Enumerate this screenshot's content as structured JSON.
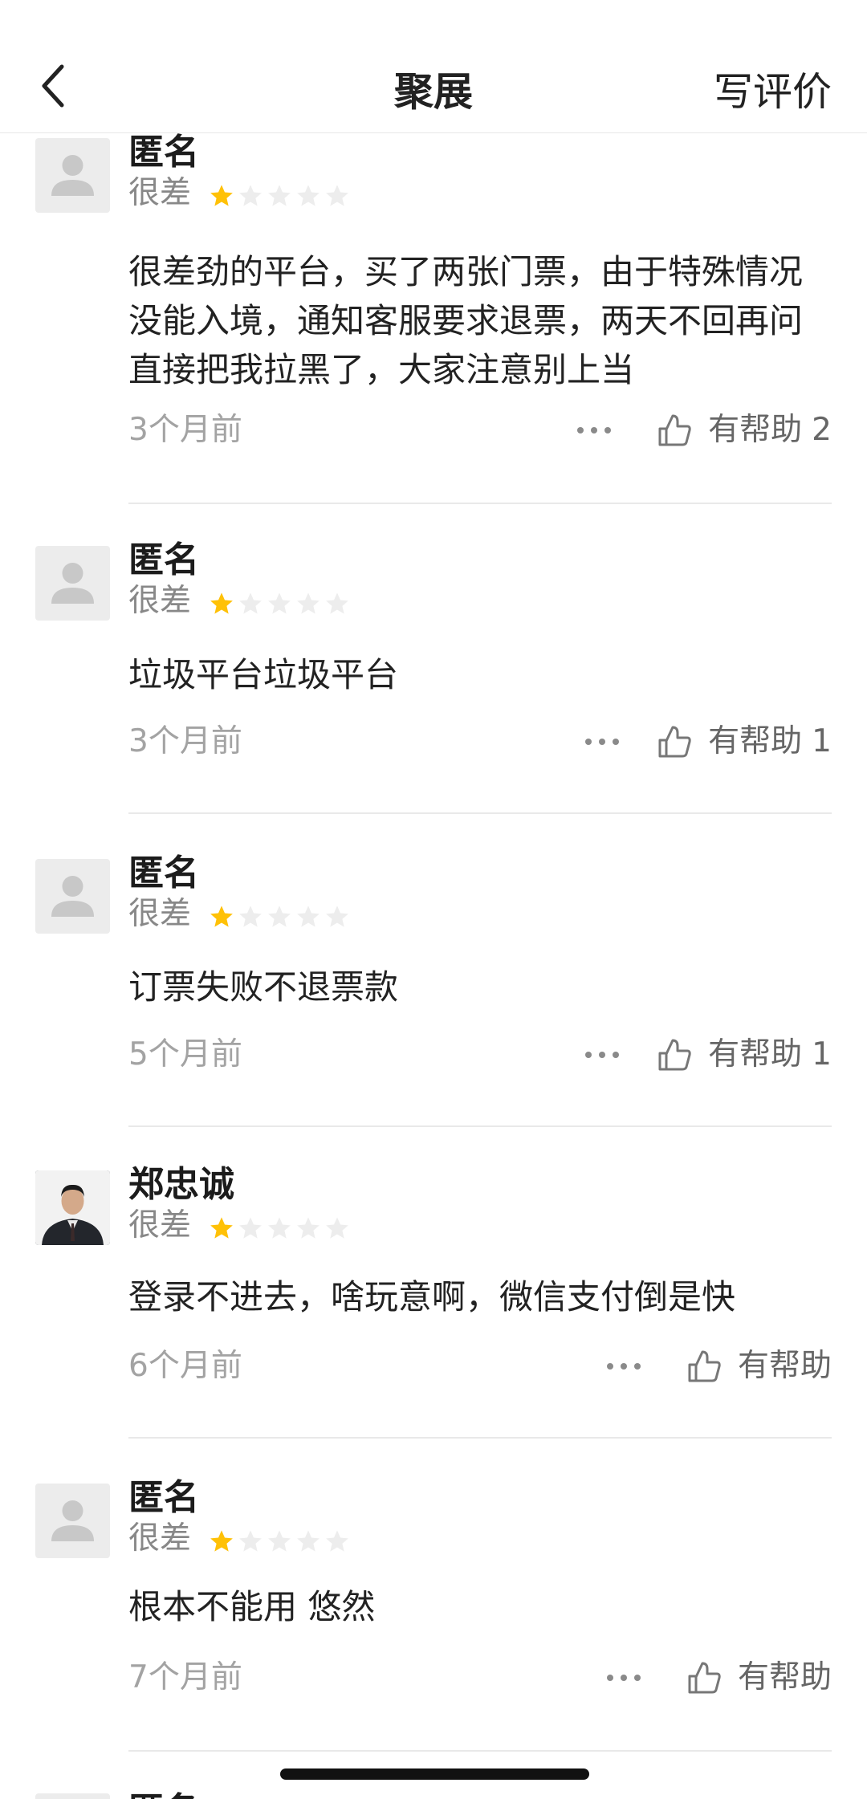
{
  "nav": {
    "title": "聚展",
    "write_review": "写评价"
  },
  "colors": {
    "star_active": "#FFC107",
    "star_inactive": "#EDEDED",
    "muted_text": "#A3A3A3"
  },
  "reviews": [
    {
      "name": "匿名",
      "rating_label": "很差",
      "stars": 1,
      "content": "很差劲的平台，买了两张门票，由于特殊情况没能入境，通知客服要求退票，两天不回再问直接把我拉黑了，大家注意别上当",
      "time": "3个月前",
      "helpful_label": "有帮助",
      "helpful_count": "2"
    },
    {
      "name": "匿名",
      "rating_label": "很差",
      "stars": 1,
      "content": "垃圾平台垃圾平台",
      "time": "3个月前",
      "helpful_label": "有帮助",
      "helpful_count": "1"
    },
    {
      "name": "匿名",
      "rating_label": "很差",
      "stars": 1,
      "content": "订票失败不退票款",
      "time": "5个月前",
      "helpful_label": "有帮助",
      "helpful_count": "1"
    },
    {
      "name": "郑忠诚",
      "rating_label": "很差",
      "stars": 1,
      "content": "登录不进去，啥玩意啊，微信支付倒是快",
      "time": "6个月前",
      "helpful_label": "有帮助",
      "helpful_count": ""
    },
    {
      "name": "匿名",
      "rating_label": "很差",
      "stars": 1,
      "content": "根本不能用 悠然",
      "time": "7个月前",
      "helpful_label": "有帮助",
      "helpful_count": ""
    },
    {
      "name": "匿名",
      "rating_label": "",
      "stars": 0,
      "content": "",
      "time": "",
      "helpful_label": "",
      "helpful_count": ""
    }
  ]
}
